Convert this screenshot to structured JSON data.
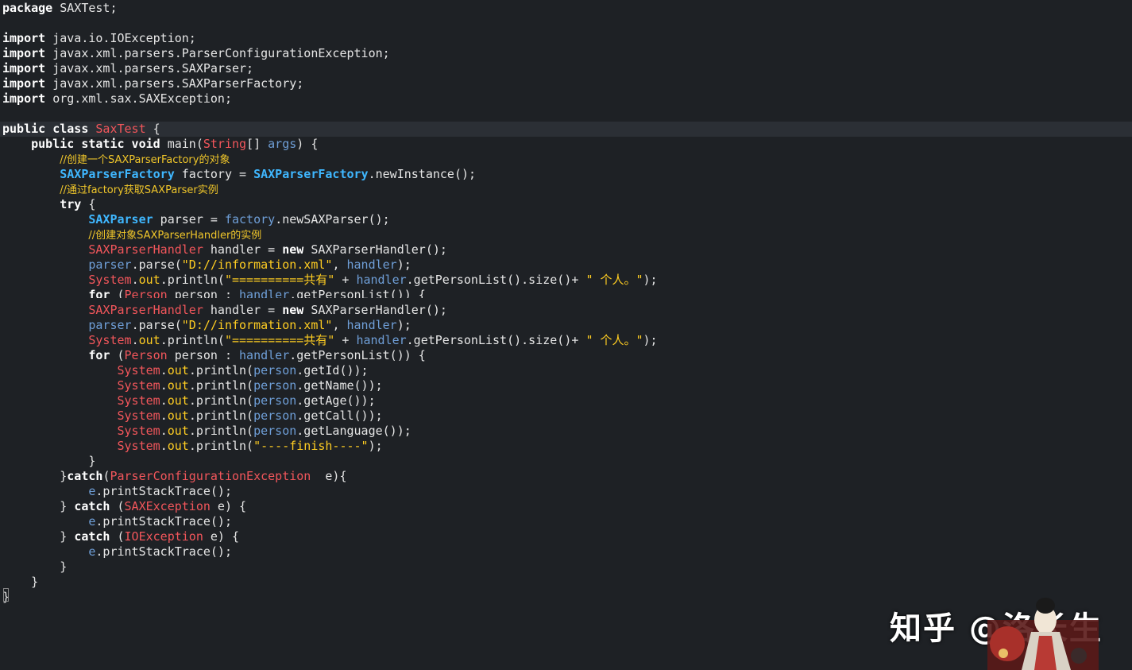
{
  "lines": [
    {
      "tokens": [
        {
          "c": "kw",
          "t": "package"
        },
        {
          "c": "pl",
          "t": " SAXTest;"
        }
      ]
    },
    {
      "tokens": []
    },
    {
      "tokens": [
        {
          "c": "kw",
          "t": "import"
        },
        {
          "c": "pl",
          "t": " java.io.IOException;"
        }
      ]
    },
    {
      "tokens": [
        {
          "c": "kw",
          "t": "import"
        },
        {
          "c": "pl",
          "t": " javax.xml.parsers.ParserConfigurationException;"
        }
      ]
    },
    {
      "tokens": [
        {
          "c": "kw",
          "t": "import"
        },
        {
          "c": "pl",
          "t": " javax.xml.parsers.SAXParser;"
        }
      ]
    },
    {
      "tokens": [
        {
          "c": "kw",
          "t": "import"
        },
        {
          "c": "pl",
          "t": " javax.xml.parsers.SAXParserFactory;"
        }
      ]
    },
    {
      "tokens": [
        {
          "c": "kw",
          "t": "import"
        },
        {
          "c": "pl",
          "t": " org.xml.sax.SAXException;"
        }
      ]
    },
    {
      "tokens": []
    },
    {
      "tokens": [
        {
          "c": "kw",
          "t": "public class "
        },
        {
          "c": "ty",
          "t": "SaxTest"
        },
        {
          "c": "pl",
          "t": " {"
        }
      ],
      "highlight": true
    },
    {
      "tokens": [
        {
          "c": "pl",
          "t": "    "
        },
        {
          "c": "kw",
          "t": "public static void "
        },
        {
          "c": "fn",
          "t": "main("
        },
        {
          "c": "ty",
          "t": "String"
        },
        {
          "c": "pl",
          "t": "[] "
        },
        {
          "c": "var",
          "t": "args"
        },
        {
          "c": "pl",
          "t": ") {"
        }
      ]
    },
    {
      "tokens": [
        {
          "c": "pl",
          "t": "        "
        },
        {
          "c": "cm",
          "t": "//创建一个SAXParserFactory的对象"
        }
      ]
    },
    {
      "tokens": [
        {
          "c": "pl",
          "t": "        "
        },
        {
          "c": "cl",
          "t": "SAXParserFactory"
        },
        {
          "c": "pl",
          "t": " factory = "
        },
        {
          "c": "cl",
          "t": "SAXParserFactory"
        },
        {
          "c": "pl",
          "t": ".newInstance();"
        }
      ]
    },
    {
      "tokens": [
        {
          "c": "pl",
          "t": "        "
        },
        {
          "c": "cm",
          "t": "//通过factory获取SAXParser实例"
        }
      ]
    },
    {
      "tokens": [
        {
          "c": "pl",
          "t": "        "
        },
        {
          "c": "kw",
          "t": "try"
        },
        {
          "c": "pl",
          "t": " {"
        }
      ]
    },
    {
      "tokens": [
        {
          "c": "pl",
          "t": "            "
        },
        {
          "c": "cl",
          "t": "SAXParser"
        },
        {
          "c": "pl",
          "t": " parser = "
        },
        {
          "c": "var",
          "t": "factory"
        },
        {
          "c": "pl",
          "t": ".newSAXParser();"
        }
      ]
    },
    {
      "tokens": [
        {
          "c": "pl",
          "t": "            "
        },
        {
          "c": "cm",
          "t": "//创建对象SAXParserHandler的实例"
        }
      ]
    },
    {
      "tokens": [
        {
          "c": "pl",
          "t": "            "
        },
        {
          "c": "ty",
          "t": "SAXParserHandler"
        },
        {
          "c": "pl",
          "t": " handler = "
        },
        {
          "c": "kw",
          "t": "new"
        },
        {
          "c": "pl",
          "t": " SAXParserHandler();"
        }
      ]
    },
    {
      "tokens": [
        {
          "c": "pl",
          "t": "            "
        },
        {
          "c": "var",
          "t": "parser"
        },
        {
          "c": "pl",
          "t": ".parse("
        },
        {
          "c": "st",
          "t": "\"D://information.xml\""
        },
        {
          "c": "pl",
          "t": ", "
        },
        {
          "c": "var",
          "t": "handler"
        },
        {
          "c": "pl",
          "t": ");"
        }
      ]
    },
    {
      "tokens": [
        {
          "c": "pl",
          "t": "            "
        },
        {
          "c": "ty",
          "t": "System"
        },
        {
          "c": "pl",
          "t": "."
        },
        {
          "c": "st",
          "t": "out"
        },
        {
          "c": "pl",
          "t": ".println("
        },
        {
          "c": "st",
          "t": "\"==========共有\""
        },
        {
          "c": "pl",
          "t": " + "
        },
        {
          "c": "var",
          "t": "handler"
        },
        {
          "c": "pl",
          "t": ".getPersonList().size()+ "
        },
        {
          "c": "st",
          "t": "\" 个人。\""
        },
        {
          "c": "pl",
          "t": ");"
        }
      ]
    },
    {
      "tokens": [
        {
          "c": "pl",
          "t": "            "
        },
        {
          "c": "kw",
          "t": "for"
        },
        {
          "c": "pl",
          "t": " ("
        },
        {
          "c": "ty",
          "t": "Person"
        },
        {
          "c": "pl",
          "t": " person : "
        },
        {
          "c": "var",
          "t": "handler"
        },
        {
          "c": "pl",
          "t": ".getPersonList()) {"
        }
      ],
      "cut": true
    },
    {
      "tokens": [
        {
          "c": "pl",
          "t": "            "
        },
        {
          "c": "ty",
          "t": "SAXParserHandler"
        },
        {
          "c": "pl",
          "t": " handler = "
        },
        {
          "c": "kw",
          "t": "new"
        },
        {
          "c": "pl",
          "t": " SAXParserHandler();"
        }
      ]
    },
    {
      "tokens": [
        {
          "c": "pl",
          "t": "            "
        },
        {
          "c": "var",
          "t": "parser"
        },
        {
          "c": "pl",
          "t": ".parse("
        },
        {
          "c": "st",
          "t": "\"D://information.xml\""
        },
        {
          "c": "pl",
          "t": ", "
        },
        {
          "c": "var",
          "t": "handler"
        },
        {
          "c": "pl",
          "t": ");"
        }
      ]
    },
    {
      "tokens": [
        {
          "c": "pl",
          "t": "            "
        },
        {
          "c": "ty",
          "t": "System"
        },
        {
          "c": "pl",
          "t": "."
        },
        {
          "c": "st",
          "t": "out"
        },
        {
          "c": "pl",
          "t": ".println("
        },
        {
          "c": "st",
          "t": "\"==========共有\""
        },
        {
          "c": "pl",
          "t": " + "
        },
        {
          "c": "var",
          "t": "handler"
        },
        {
          "c": "pl",
          "t": ".getPersonList().size()+ "
        },
        {
          "c": "st",
          "t": "\" 个人。\""
        },
        {
          "c": "pl",
          "t": ");"
        }
      ]
    },
    {
      "tokens": [
        {
          "c": "pl",
          "t": "            "
        },
        {
          "c": "kw",
          "t": "for"
        },
        {
          "c": "pl",
          "t": " ("
        },
        {
          "c": "ty",
          "t": "Person"
        },
        {
          "c": "pl",
          "t": " person : "
        },
        {
          "c": "var",
          "t": "handler"
        },
        {
          "c": "pl",
          "t": ".getPersonList()) {"
        }
      ]
    },
    {
      "tokens": [
        {
          "c": "pl",
          "t": "                "
        },
        {
          "c": "ty",
          "t": "System"
        },
        {
          "c": "pl",
          "t": "."
        },
        {
          "c": "st",
          "t": "out"
        },
        {
          "c": "pl",
          "t": ".println("
        },
        {
          "c": "var",
          "t": "person"
        },
        {
          "c": "pl",
          "t": ".getId());"
        }
      ]
    },
    {
      "tokens": [
        {
          "c": "pl",
          "t": "                "
        },
        {
          "c": "ty",
          "t": "System"
        },
        {
          "c": "pl",
          "t": "."
        },
        {
          "c": "st",
          "t": "out"
        },
        {
          "c": "pl",
          "t": ".println("
        },
        {
          "c": "var",
          "t": "person"
        },
        {
          "c": "pl",
          "t": ".getName());"
        }
      ]
    },
    {
      "tokens": [
        {
          "c": "pl",
          "t": "                "
        },
        {
          "c": "ty",
          "t": "System"
        },
        {
          "c": "pl",
          "t": "."
        },
        {
          "c": "st",
          "t": "out"
        },
        {
          "c": "pl",
          "t": ".println("
        },
        {
          "c": "var",
          "t": "person"
        },
        {
          "c": "pl",
          "t": ".getAge());"
        }
      ]
    },
    {
      "tokens": [
        {
          "c": "pl",
          "t": "                "
        },
        {
          "c": "ty",
          "t": "System"
        },
        {
          "c": "pl",
          "t": "."
        },
        {
          "c": "st",
          "t": "out"
        },
        {
          "c": "pl",
          "t": ".println("
        },
        {
          "c": "var",
          "t": "person"
        },
        {
          "c": "pl",
          "t": ".getCall());"
        }
      ]
    },
    {
      "tokens": [
        {
          "c": "pl",
          "t": "                "
        },
        {
          "c": "ty",
          "t": "System"
        },
        {
          "c": "pl",
          "t": "."
        },
        {
          "c": "st",
          "t": "out"
        },
        {
          "c": "pl",
          "t": ".println("
        },
        {
          "c": "var",
          "t": "person"
        },
        {
          "c": "pl",
          "t": ".getLanguage());"
        }
      ]
    },
    {
      "tokens": [
        {
          "c": "pl",
          "t": "                "
        },
        {
          "c": "ty",
          "t": "System"
        },
        {
          "c": "pl",
          "t": "."
        },
        {
          "c": "st",
          "t": "out"
        },
        {
          "c": "pl",
          "t": ".println("
        },
        {
          "c": "st",
          "t": "\"----finish----\""
        },
        {
          "c": "pl",
          "t": ");"
        }
      ]
    },
    {
      "tokens": [
        {
          "c": "pl",
          "t": "            }"
        }
      ]
    },
    {
      "tokens": [
        {
          "c": "pl",
          "t": "        }"
        },
        {
          "c": "kw",
          "t": "catch"
        },
        {
          "c": "pl",
          "t": "("
        },
        {
          "c": "ty",
          "t": "ParserConfigurationException"
        },
        {
          "c": "pl",
          "t": "  e){"
        }
      ]
    },
    {
      "tokens": [
        {
          "c": "pl",
          "t": "            "
        },
        {
          "c": "var",
          "t": "e"
        },
        {
          "c": "pl",
          "t": ".printStackTrace();"
        }
      ]
    },
    {
      "tokens": [
        {
          "c": "pl",
          "t": "        } "
        },
        {
          "c": "kw",
          "t": "catch"
        },
        {
          "c": "pl",
          "t": " ("
        },
        {
          "c": "ty",
          "t": "SAXException"
        },
        {
          "c": "pl",
          "t": " e) {"
        }
      ]
    },
    {
      "tokens": [
        {
          "c": "pl",
          "t": "            "
        },
        {
          "c": "var",
          "t": "e"
        },
        {
          "c": "pl",
          "t": ".printStackTrace();"
        }
      ]
    },
    {
      "tokens": [
        {
          "c": "pl",
          "t": "        } "
        },
        {
          "c": "kw",
          "t": "catch"
        },
        {
          "c": "pl",
          "t": " ("
        },
        {
          "c": "ty",
          "t": "IOException"
        },
        {
          "c": "pl",
          "t": " e) {"
        }
      ]
    },
    {
      "tokens": [
        {
          "c": "pl",
          "t": "            "
        },
        {
          "c": "var",
          "t": "e"
        },
        {
          "c": "pl",
          "t": ".printStackTrace();"
        }
      ]
    },
    {
      "tokens": [
        {
          "c": "pl",
          "t": "        }"
        }
      ]
    },
    {
      "tokens": [
        {
          "c": "pl",
          "t": "    }"
        }
      ]
    },
    {
      "tokens": [
        {
          "c": "pl",
          "t": "}"
        }
      ]
    }
  ],
  "watermark": "知乎 @洛长生",
  "icons": {
    "avatar": "watermark-avatar-icon"
  }
}
